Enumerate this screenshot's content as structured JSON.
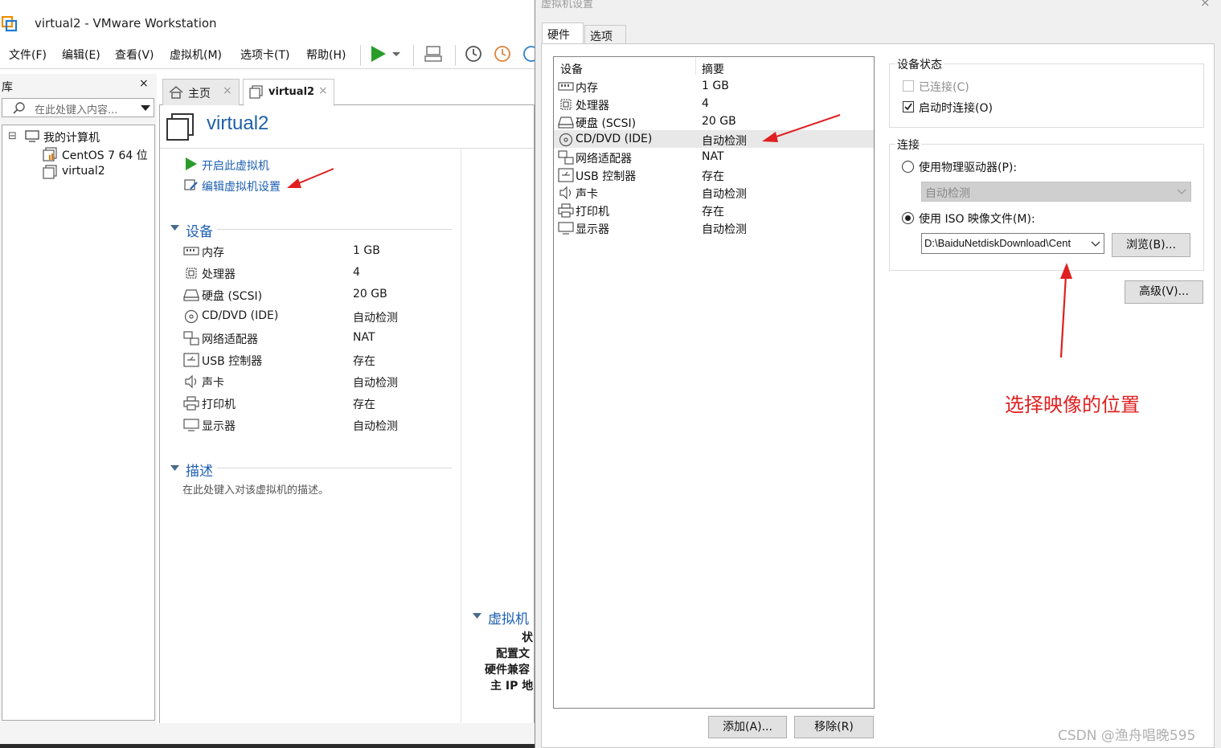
{
  "window": {
    "title": "virtual2 - VMware Workstation"
  },
  "menu": [
    "文件(F)",
    "编辑(E)",
    "查看(V)",
    "虚拟机(M)",
    "选项卡(T)",
    "帮助(H)"
  ],
  "library": {
    "title": "库",
    "close": "×",
    "search_placeholder": "在此处键入内容...",
    "tree": [
      {
        "label": "我的计算机",
        "expander": "⊟"
      },
      {
        "label": "CentOS 7 64 位"
      },
      {
        "label": "virtual2"
      }
    ]
  },
  "tabs": [
    {
      "label": "主页"
    },
    {
      "label": "virtual2"
    }
  ],
  "vm": {
    "name": "virtual2",
    "actions": [
      "开启此虚拟机",
      "编辑虚拟机设置"
    ],
    "devices_heading": "设备",
    "devices": [
      {
        "name": "内存",
        "value": "1 GB"
      },
      {
        "name": "处理器",
        "value": "4"
      },
      {
        "name": "硬盘 (SCSI)",
        "value": "20 GB"
      },
      {
        "name": "CD/DVD (IDE)",
        "value": "自动检测"
      },
      {
        "name": "网络适配器",
        "value": "NAT"
      },
      {
        "name": "USB 控制器",
        "value": "存在"
      },
      {
        "name": "声卡",
        "value": "自动检测"
      },
      {
        "name": "打印机",
        "value": "存在"
      },
      {
        "name": "显示器",
        "value": "自动检测"
      }
    ],
    "desc_heading": "描述",
    "desc_placeholder": "在此处键入对该虚拟机的描述。",
    "details_heading": "虚拟机",
    "details_labels": [
      "状",
      "配置文",
      "硬件兼容",
      "主 IP 地"
    ]
  },
  "dialog": {
    "title": "虚拟机设置",
    "close": "×",
    "tabs": [
      "硬件",
      "选项"
    ],
    "list_headers": [
      "设备",
      "摘要"
    ],
    "list": [
      {
        "name": "内存",
        "summary": "1 GB"
      },
      {
        "name": "处理器",
        "summary": "4"
      },
      {
        "name": "硬盘 (SCSI)",
        "summary": "20 GB"
      },
      {
        "name": "CD/DVD (IDE)",
        "summary": "自动检测"
      },
      {
        "name": "网络适配器",
        "summary": "NAT"
      },
      {
        "name": "USB 控制器",
        "summary": "存在"
      },
      {
        "name": "声卡",
        "summary": "自动检测"
      },
      {
        "name": "打印机",
        "summary": "存在"
      },
      {
        "name": "显示器",
        "summary": "自动检测"
      }
    ],
    "add_button": "添加(A)...",
    "remove_button": "移除(R)",
    "device_status": {
      "title": "设备状态",
      "connected": "已连接(C)",
      "connect_at_power_on": "启动时连接(O)"
    },
    "connection": {
      "title": "连接",
      "physical": "使用物理驱动器(P):",
      "physical_value": "自动检测",
      "iso": "使用 ISO 映像文件(M):",
      "iso_value": "D:\\BaiduNetdiskDownload\\Cent",
      "browse": "浏览(B)..."
    },
    "advanced": "高级(V)..."
  },
  "annotation": "选择映像的位置",
  "watermark": "CSDN @渔舟唱晚595",
  "colors": {
    "accent_blue": "#1e5fb3",
    "annotation_red": "#e02020",
    "play_green": "#2a9c2a"
  }
}
